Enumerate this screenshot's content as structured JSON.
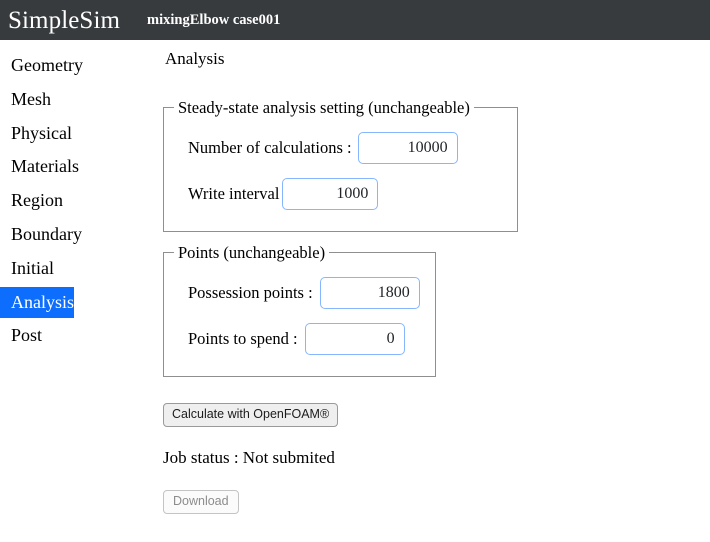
{
  "header": {
    "brand": "SimpleSim",
    "case_name": "mixingElbow case001",
    "background_color": "#373b3e"
  },
  "sidebar": {
    "active_item": "Analysis",
    "active_color": "#0d6efd",
    "items": [
      {
        "label": "Geometry"
      },
      {
        "label": "Mesh"
      },
      {
        "label": "Physical"
      },
      {
        "label": "Materials"
      },
      {
        "label": "Region"
      },
      {
        "label": "Boundary"
      },
      {
        "label": "Initial"
      },
      {
        "label": "Analysis"
      },
      {
        "label": "Post"
      }
    ]
  },
  "main": {
    "page_title": "Analysis",
    "steady_panel": {
      "legend": "Steady-state analysis setting (unchangeable)",
      "num_calculations_label": "Number of calculations :",
      "num_calculations_value": "10000",
      "write_interval_label": "Write interval",
      "write_interval_value": "1000"
    },
    "points_panel": {
      "legend": "Points (unchangeable)",
      "possession_points_label": "Possession points :",
      "possession_points_value": "1800",
      "points_to_spend_label": "Points to spend :",
      "points_to_spend_value": "0"
    },
    "calculate_button_label": "Calculate with OpenFOAM®",
    "job_status_text": "Job status : Not submited",
    "download_button_label": "Download",
    "input_border_color": "#86b7fe"
  }
}
